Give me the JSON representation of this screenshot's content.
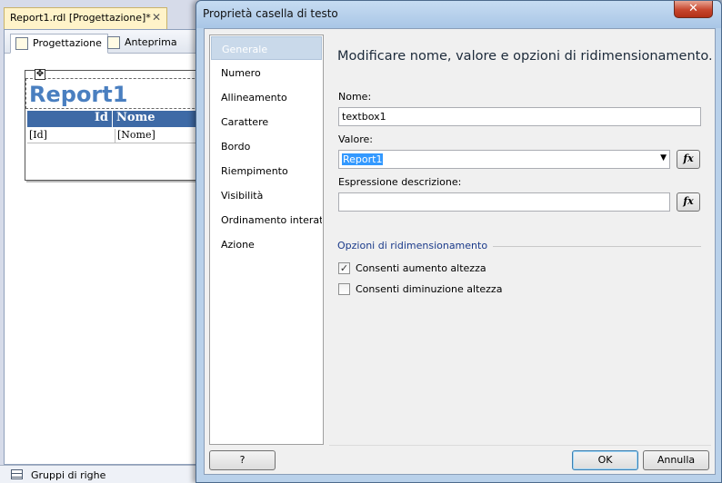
{
  "designer": {
    "doc_tab": "Report1.rdl [Progettazione]*",
    "doc_tab_close": "✕",
    "tab_design": "Progettazione",
    "tab_preview": "Anteprima",
    "report_title": "Report1",
    "header_id": "Id",
    "header_nome": "Nome",
    "cell_id": "[Id]",
    "cell_nome": "[Nome]",
    "row_groups": "Gruppi di righe"
  },
  "dialog": {
    "title": "Proprietà casella di testo",
    "close": "✕",
    "nav": [
      "Generale",
      "Numero",
      "Allineamento",
      "Carattere",
      "Bordo",
      "Riempimento",
      "Visibilità",
      "Ordinamento interat...",
      "Azione"
    ],
    "heading": "Modificare nome, valore e opzioni di ridimensionamento.",
    "name_label": "Nome:",
    "name_value": "textbox1",
    "value_label": "Valore:",
    "value_value": "Report1",
    "desc_label": "Espressione descrizione:",
    "desc_value": "",
    "fx_label": "fx",
    "group_label": "Opzioni di ridimensionamento",
    "grow_label": "Consenti aumento altezza",
    "grow_checked": true,
    "shrink_label": "Consenti diminuzione altezza",
    "shrink_checked": false,
    "help_label": "?",
    "ok_label": "OK",
    "cancel_label": "Annulla"
  }
}
